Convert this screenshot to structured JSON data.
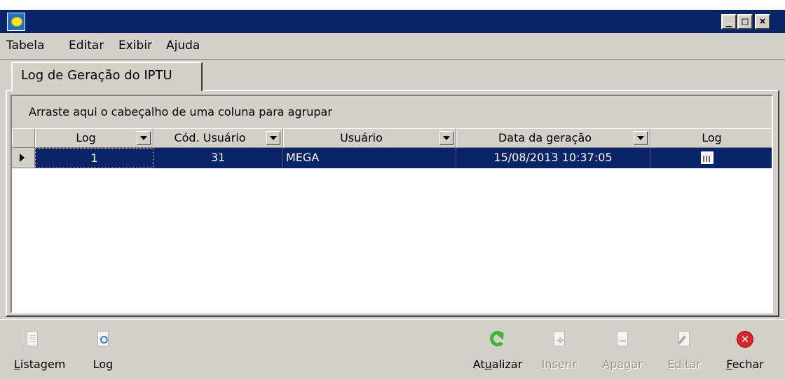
{
  "window": {
    "buttons": {
      "minimize": "_",
      "maximize": "□",
      "close": "×"
    }
  },
  "menu": [
    "Tabela",
    "Editar",
    "Exibir",
    "Ajuda"
  ],
  "tab": {
    "label": "Log de Geração do IPTU"
  },
  "grid": {
    "group_hint": "Arraste aqui o cabeçalho de uma coluna para agrupar",
    "columns": [
      "Log",
      "Cód. Usuário",
      "Usuário",
      "Data da geração",
      "Log"
    ],
    "rows": [
      {
        "log": "1",
        "cod_usuario": "31",
        "usuario": "MEGA",
        "data_geracao": "15/08/2013 10:37:05",
        "log_icon": "grid-document-icon"
      }
    ]
  },
  "toolbar": {
    "listagem": {
      "pre": "",
      "key": "L",
      "post": "istagem",
      "icon": "document-icon"
    },
    "log": {
      "pre": "",
      "key": "",
      "post": "Log",
      "icon": "document-search-icon"
    },
    "atualizar": {
      "pre": "At",
      "key": "u",
      "post": "alizar",
      "icon": "refresh-icon"
    },
    "inserir": {
      "pre": "",
      "key": "I",
      "post": "nserir",
      "icon": "document-add-icon"
    },
    "apagar": {
      "pre": "",
      "key": "A",
      "post": "pagar",
      "icon": "document-delete-icon"
    },
    "editar": {
      "pre": "",
      "key": "E",
      "post": "ditar",
      "icon": "document-edit-icon"
    },
    "fechar": {
      "pre": "",
      "key": "F",
      "post": "echar",
      "icon": "close-icon"
    }
  },
  "colors": {
    "titlebar": "#0a246a",
    "selection": "#0a246a",
    "face": "#d4d0c8"
  }
}
